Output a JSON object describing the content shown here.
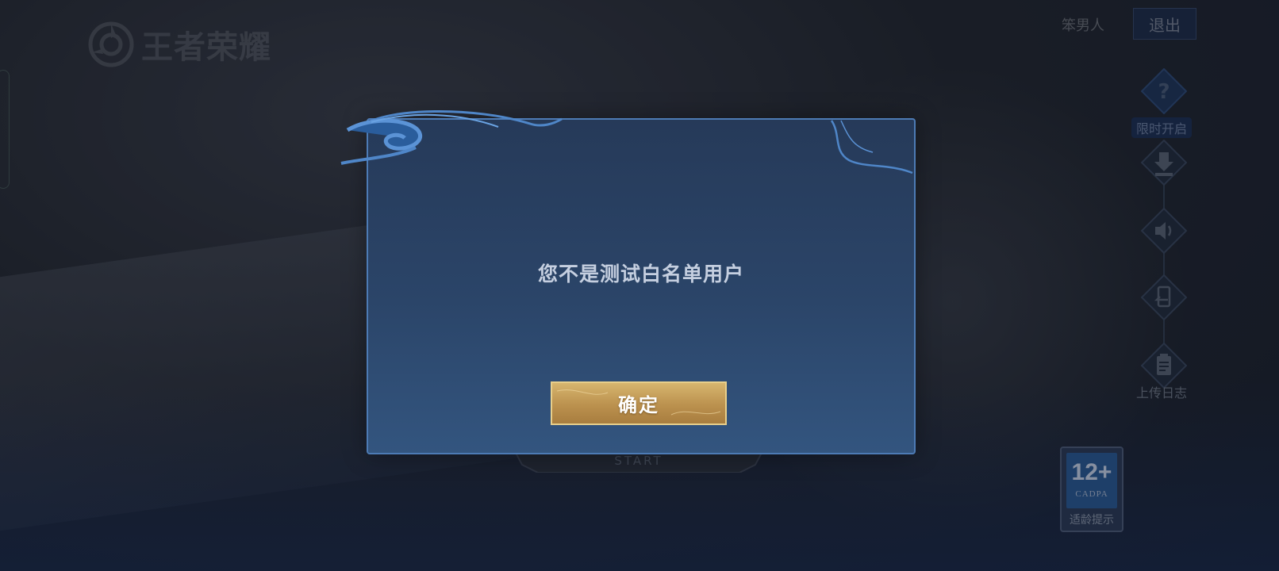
{
  "app": {
    "logo_text": "王者荣耀"
  },
  "header": {
    "username": "笨男人",
    "logout_label": "退出"
  },
  "side_tools": [
    {
      "name": "limited-open",
      "icon": "question-icon",
      "label": "限时开启"
    },
    {
      "name": "download",
      "icon": "download-icon",
      "label": ""
    },
    {
      "name": "sound",
      "icon": "speaker-icon",
      "label": ""
    },
    {
      "name": "switch-account",
      "icon": "phone-switch-icon",
      "label": ""
    },
    {
      "name": "upload-log",
      "icon": "clipboard-icon",
      "label": "上传日志"
    }
  ],
  "start_button": {
    "label": "START"
  },
  "age_rating": {
    "number": "12+",
    "org": "CADPA",
    "label": "适龄提示"
  },
  "footer": {
    "line1": "",
    "line2": ""
  },
  "dialog": {
    "message": "您不是测试白名单用户",
    "confirm_label": "确定"
  },
  "colors": {
    "dialog_border": "#4d7bb5",
    "dialog_bg": "#2b4569",
    "confirm_gold": "#c9a15c",
    "message_text": "#c5cfe0"
  }
}
